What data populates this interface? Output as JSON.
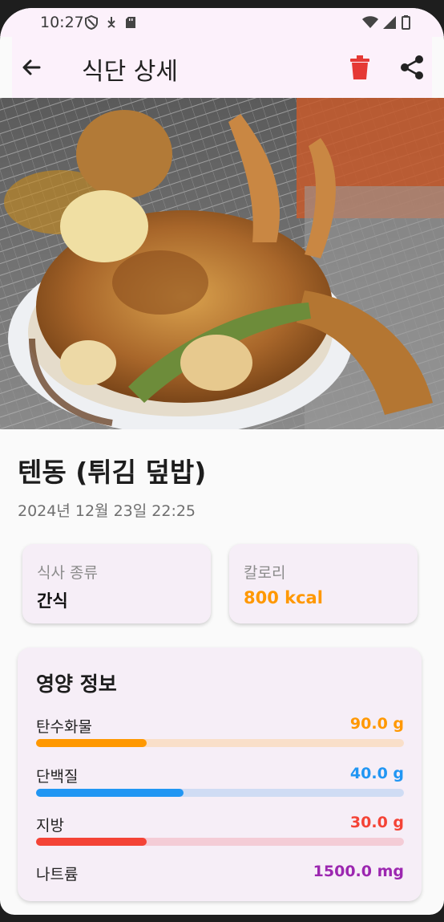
{
  "status_bar": {
    "time": "10:27",
    "left_icons": [
      "shield-icon",
      "download-icon",
      "sd-card-icon"
    ],
    "right_icons": [
      "wifi-icon",
      "signal-icon",
      "battery-icon"
    ]
  },
  "app_bar": {
    "title": "식단 상세",
    "back_icon": "arrow-back-icon",
    "actions": [
      {
        "icon": "trash-icon",
        "color": "#e53935"
      },
      {
        "icon": "share-icon",
        "color": "#222222"
      }
    ]
  },
  "hero_image": {
    "alt": "텐동 (튀김 덮밥)"
  },
  "meal": {
    "name": "텐동 (튀김 덮밥)",
    "datetime": "2024년 12월 23일 22:25"
  },
  "meal_type_card": {
    "label": "식사 종류",
    "value": "간식",
    "color": "#111111"
  },
  "calorie_card": {
    "label": "칼로리",
    "value": "800 kcal",
    "color": "#ff9800"
  },
  "nutrition": {
    "title": "영양 정보",
    "items": [
      {
        "label": "탄수화물",
        "value": "90.0 g",
        "color": "#ff9800",
        "track_color": "#f9dfc9",
        "fill": 0.3
      },
      {
        "label": "단백질",
        "value": "40.0 g",
        "color": "#2196f3",
        "track_color": "#cfdcf4",
        "fill": 0.4
      },
      {
        "label": "지방",
        "value": "30.0 g",
        "color": "#f44336",
        "track_color": "#f4ccd6",
        "fill": 0.3
      },
      {
        "label": "나트륨",
        "value": "1500.0 mg",
        "color": "#9c27b0"
      }
    ]
  }
}
